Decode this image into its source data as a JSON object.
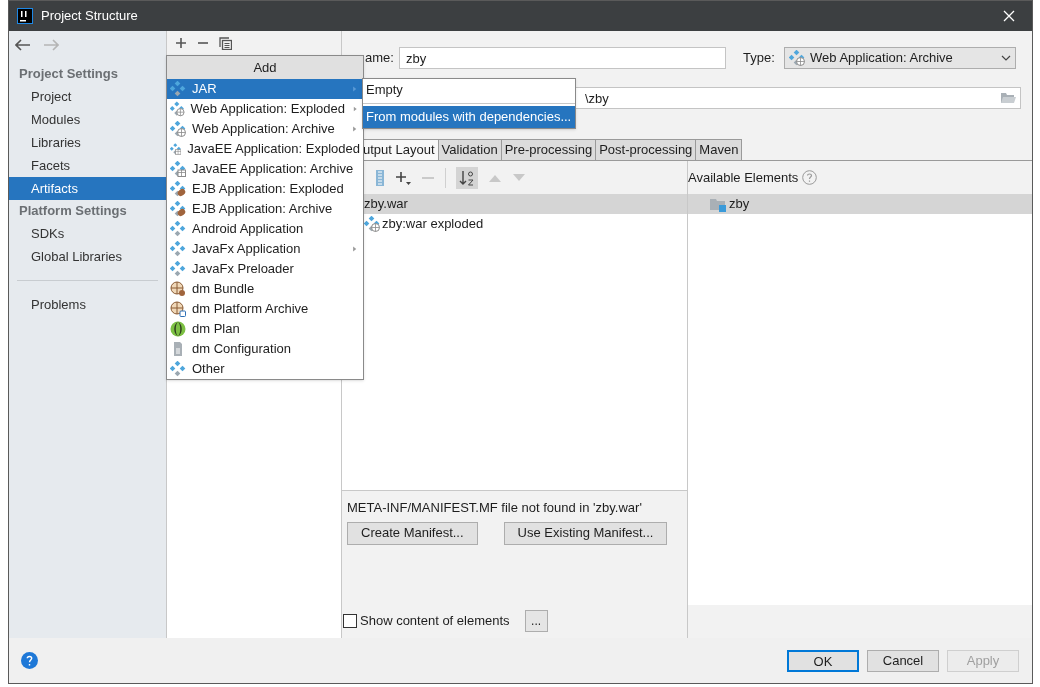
{
  "window": {
    "title": "Project Structure"
  },
  "sidebar": {
    "sections": [
      {
        "heading": "Project Settings",
        "items": [
          {
            "label": "Project",
            "selected": false
          },
          {
            "label": "Modules",
            "selected": false
          },
          {
            "label": "Libraries",
            "selected": false
          },
          {
            "label": "Facets",
            "selected": false
          },
          {
            "label": "Artifacts",
            "selected": true
          }
        ]
      },
      {
        "heading": "Platform Settings",
        "items": [
          {
            "label": "SDKs",
            "selected": false
          },
          {
            "label": "Global Libraries",
            "selected": false
          }
        ]
      },
      {
        "items": [
          {
            "label": "Problems",
            "selected": false
          }
        ]
      }
    ]
  },
  "add_menu": {
    "title": "Add",
    "items": [
      {
        "label": "JAR",
        "kind": "module",
        "submenu": true,
        "selected": true
      },
      {
        "label": "Web Application: Exploded",
        "kind": "web",
        "submenu": true,
        "selected": false
      },
      {
        "label": "Web Application: Archive",
        "kind": "web",
        "submenu": true,
        "selected": false
      },
      {
        "label": "JavaEE Application: Exploded",
        "kind": "javaee",
        "submenu": false,
        "selected": false
      },
      {
        "label": "JavaEE Application: Archive",
        "kind": "javaee",
        "submenu": false,
        "selected": false
      },
      {
        "label": "EJB Application: Exploded",
        "kind": "ejb",
        "submenu": false,
        "selected": false
      },
      {
        "label": "EJB Application: Archive",
        "kind": "ejb",
        "submenu": false,
        "selected": false
      },
      {
        "label": "Android Application",
        "kind": "module",
        "submenu": false,
        "selected": false
      },
      {
        "label": "JavaFx Application",
        "kind": "module",
        "submenu": true,
        "selected": false
      },
      {
        "label": "JavaFx Preloader",
        "kind": "module",
        "submenu": false,
        "selected": false
      },
      {
        "label": "dm Bundle",
        "kind": "dm-bundle",
        "submenu": false,
        "selected": false
      },
      {
        "label": "dm Platform Archive",
        "kind": "dm-archive",
        "submenu": false,
        "selected": false
      },
      {
        "label": "dm Plan",
        "kind": "dm-plan",
        "submenu": false,
        "selected": false
      },
      {
        "label": "dm Configuration",
        "kind": "dm-config",
        "submenu": false,
        "selected": false
      },
      {
        "label": "Other",
        "kind": "module",
        "submenu": false,
        "selected": false
      }
    ]
  },
  "submenu": {
    "items": [
      {
        "label": "Empty",
        "selected": false
      },
      {
        "label": "From modules with dependencies...",
        "selected": true
      }
    ]
  },
  "artifact": {
    "name_label": "ame:",
    "name": "zby",
    "type_label": "Type:",
    "type": "Web Application: Archive",
    "output_dir": "\\zby"
  },
  "tabs": [
    {
      "label": "utput Layout",
      "selected": true
    },
    {
      "label": "Validation",
      "selected": false
    },
    {
      "label": "Pre-processing",
      "selected": false
    },
    {
      "label": "Post-processing",
      "selected": false
    },
    {
      "label": "Maven",
      "selected": false
    }
  ],
  "layout_tree": {
    "items": [
      {
        "label": "zby.war",
        "selected": true
      },
      {
        "label": "zby:war exploded",
        "selected": false
      }
    ]
  },
  "available": {
    "title": "Available Elements",
    "items": [
      {
        "label": "zby",
        "selected": true
      }
    ]
  },
  "manifest": {
    "message": "META-INF/MANIFEST.MF file not found in 'zby.war'",
    "buttons": [
      "Create Manifest...",
      "Use Existing Manifest..."
    ]
  },
  "show_content": {
    "label": "Show content of elements",
    "checked": false,
    "more": "..."
  },
  "footer": {
    "buttons": [
      {
        "label": "OK",
        "default": true,
        "disabled": false
      },
      {
        "label": "Cancel",
        "default": false,
        "disabled": false
      },
      {
        "label": "Apply",
        "default": false,
        "disabled": true
      }
    ]
  }
}
